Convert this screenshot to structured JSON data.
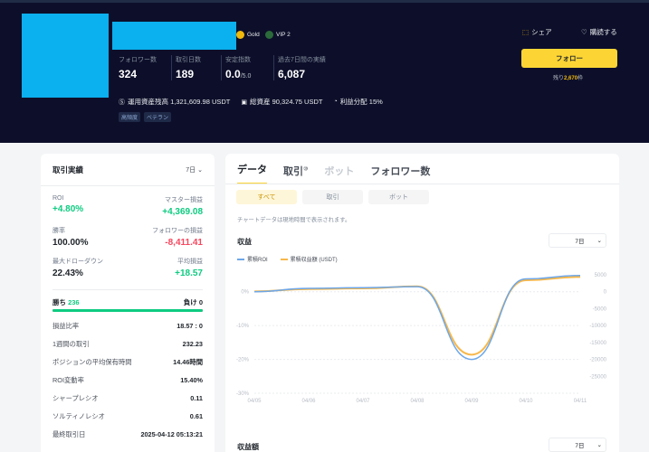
{
  "profile": {
    "badge_gold": "Gold",
    "badge_vip": "VIP 2",
    "share_label": "シェア",
    "fav_label": "購読する",
    "follow_button": "フォロー",
    "remaining_prefix": "残り",
    "remaining_value": "2,670",
    "remaining_suffix": "枠",
    "stats": [
      {
        "label": "フォロワー数",
        "value": "324"
      },
      {
        "label": "取引日数",
        "value": "189"
      },
      {
        "label": "安定指数",
        "value": "0.0",
        "suffix": "/5.0"
      },
      {
        "label": "過去7日間の実績",
        "value": "6,087"
      }
    ],
    "aum": "運用資産残高 1,321,609.98 USDT",
    "total_assets": "総資産 90,324.75 USDT",
    "profit_share": "利益分配 15%",
    "tags": [
      "高頻度",
      "ベテラン"
    ]
  },
  "performance": {
    "title": "取引実績",
    "period": "7日",
    "roi_label": "ROI",
    "roi_value": "+4.80%",
    "master_pnl_label": "マスター損益",
    "master_pnl_value": "+4,369.08",
    "win_rate_label": "勝率",
    "win_rate_value": "100.00%",
    "follower_pnl_label": "フォロワーの損益",
    "follower_pnl_value": "-8,411.41",
    "max_dd_label": "最大ドローダウン",
    "max_dd_value": "22.43%",
    "avg_pnl_label": "平均損益",
    "avg_pnl_value": "+18.57",
    "wins_label": "勝ち",
    "wins_value": "236",
    "losses_label": "負け",
    "losses_value": "0",
    "win_fraction": 1.0,
    "rows": [
      {
        "label": "損益比率",
        "value": "18.57 : 0"
      },
      {
        "label": "1週間の取引",
        "value": "232.23"
      },
      {
        "label": "ポジションの平均保有時間",
        "value": "14.46時間"
      },
      {
        "label": "ROI変動率",
        "value": "15.40%"
      },
      {
        "label": "シャープレシオ",
        "value": "0.11"
      },
      {
        "label": "ソルティノレシオ",
        "value": "0.61"
      },
      {
        "label": "最終取引日",
        "value": "2025-04-12 05:13:21"
      }
    ]
  },
  "tabs": [
    {
      "label": "データ",
      "active": true
    },
    {
      "label": "取引",
      "sup": "⑩"
    },
    {
      "label": "ボット",
      "disabled": true
    },
    {
      "label": "フォロワー数"
    }
  ],
  "subtabs": [
    "すべて",
    "取引",
    "ボット"
  ],
  "note": "チャートデータは現地時間で表示されます。",
  "profit_section": {
    "title": "収益",
    "period": "7日"
  },
  "profit_amount_section": {
    "title": "収益額",
    "period": "7日"
  },
  "colors": {
    "roi": "#6ea7e8",
    "pnl": "#f7b84b",
    "accent": "#fcd535",
    "green": "#0ecb81",
    "red": "#f6465d"
  },
  "chart_data": {
    "type": "line",
    "x": [
      "04/05",
      "04/06",
      "04/07",
      "04/08",
      "04/09",
      "04/10",
      "04/11"
    ],
    "series": [
      {
        "name": "累積ROI",
        "axis": "left",
        "values": [
          0.0,
          1.0,
          1.2,
          1.5,
          -20.0,
          3.8,
          4.8
        ]
      },
      {
        "name": "累積収益額 (USDT)",
        "axis": "right",
        "values": [
          100,
          800,
          1000,
          1600,
          -18600,
          3400,
          4369
        ]
      }
    ],
    "y_left_ticks": [
      "0%",
      "-10%",
      "-20%",
      "-30%"
    ],
    "y_left_range": [
      -30,
      5
    ],
    "y_right_ticks": [
      "5000",
      "0",
      "-5000",
      "-10000",
      "-15000",
      "-20000",
      "-25000"
    ],
    "y_right_range": [
      -30000,
      5000
    ],
    "grid": true,
    "legend": "top-left"
  }
}
